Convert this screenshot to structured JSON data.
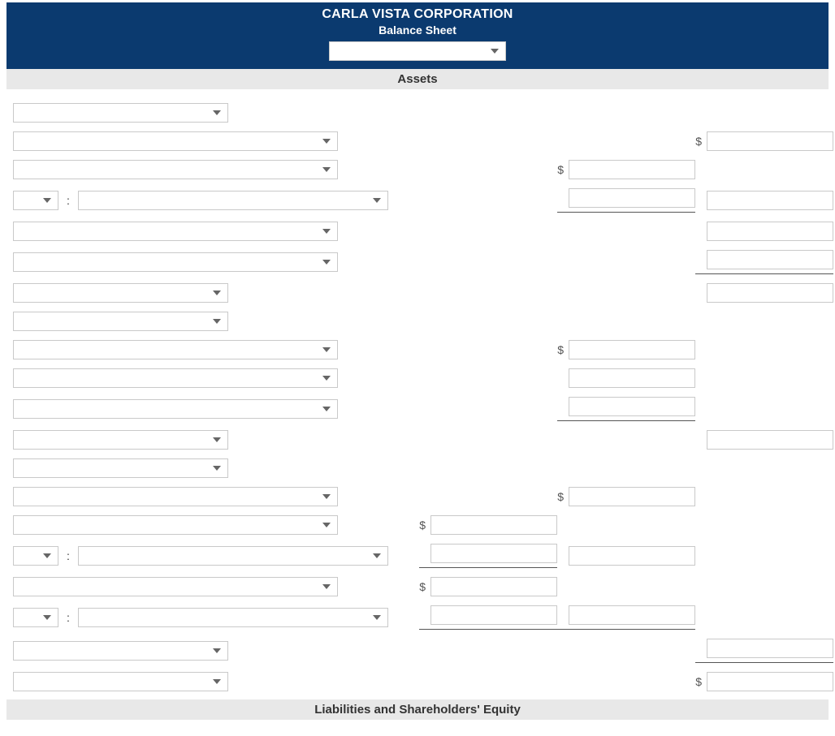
{
  "header": {
    "company": "CARLA VISTA CORPORATION",
    "title": "Balance Sheet",
    "date_value": ""
  },
  "sections": {
    "assets": "Assets",
    "liab_equity": "Liabilities and Shareholders' Equity"
  },
  "symbols": {
    "dollar": "$",
    "colon": ":"
  },
  "rows": {
    "r1": {
      "label": ""
    },
    "r2": {
      "label": "",
      "amt4": ""
    },
    "r3": {
      "label": "",
      "amt3": ""
    },
    "r4": {
      "small": "",
      "big": "",
      "amt3": "",
      "amt4": ""
    },
    "r5": {
      "label": "",
      "amt4": ""
    },
    "r6": {
      "label": "",
      "amt4": ""
    },
    "r7": {
      "label": "",
      "amt4": ""
    },
    "r8": {
      "label": ""
    },
    "r9": {
      "label": "",
      "amt3": ""
    },
    "r10": {
      "label": "",
      "amt3": ""
    },
    "r11": {
      "label": "",
      "amt3": ""
    },
    "r12": {
      "label": "",
      "amt4": ""
    },
    "r13": {
      "label": ""
    },
    "r14": {
      "label": "",
      "amt3": ""
    },
    "r15": {
      "label": "",
      "amt2": ""
    },
    "r16": {
      "small": "",
      "big": "",
      "amt2": "",
      "amt3": ""
    },
    "r17": {
      "label": "",
      "amt2": ""
    },
    "r18": {
      "small": "",
      "big": "",
      "amt2": "",
      "amt3": ""
    },
    "r19": {
      "label": "",
      "amt4": ""
    },
    "r20": {
      "label": "",
      "amt4": ""
    }
  }
}
